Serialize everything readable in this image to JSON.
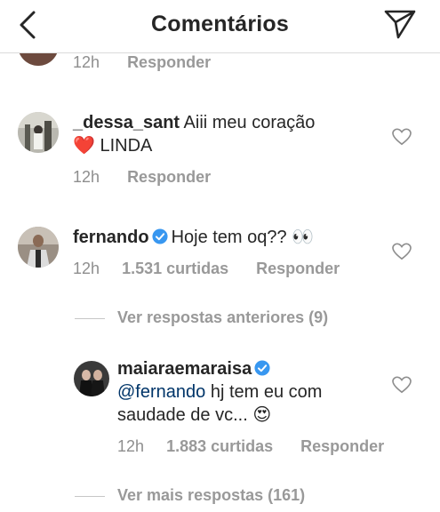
{
  "header": {
    "title": "Comentários"
  },
  "comments": [
    {
      "time": "12h",
      "reply": "Responder"
    },
    {
      "username": "_dessa_sant",
      "text": "Aiii meu coração",
      "text2": "LINDA",
      "emoji": "❤️",
      "time": "12h",
      "reply": "Responder"
    },
    {
      "username": "fernando",
      "verified": true,
      "text": "Hoje tem oq??",
      "emoji": "👀",
      "time": "12h",
      "likes": "1.531 curtidas",
      "reply": "Responder"
    }
  ],
  "thread": {
    "previous_replies": "Ver respostas anteriores (9)",
    "more_replies": "Ver mais respostas (161)"
  },
  "reply": {
    "username": "maiaraemaraisa",
    "verified": true,
    "mention": "@fernando",
    "text": " hj tem eu com",
    "text2": "saudade de vc...",
    "emoji": "😍",
    "time": "12h",
    "likes": "1.883 curtidas",
    "reply": "Responder"
  },
  "colors": {
    "text": "#262626",
    "secondary": "#8e8e8e",
    "verified": "#3897f0",
    "mention": "#003569",
    "divider": "#dbdbdb"
  }
}
